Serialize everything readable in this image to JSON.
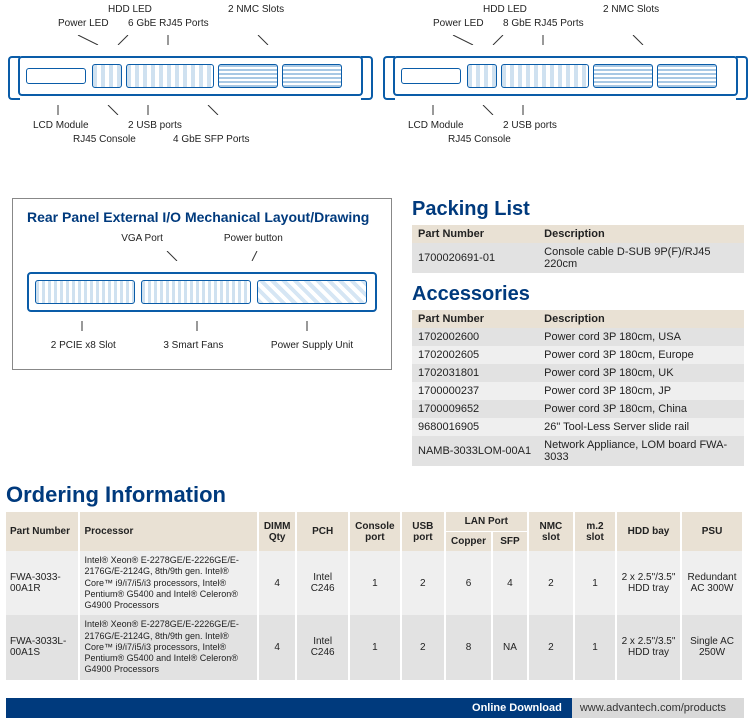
{
  "front_diag": {
    "variants": [
      {
        "top": {
          "hdd": "HDD LED",
          "power": "Power LED",
          "rj45": "6 GbE RJ45 Ports",
          "nmc": "2 NMC Slots"
        },
        "bot": {
          "lcd": "LCD Module",
          "rj45c": "RJ45 Console",
          "usb": "2 USB ports",
          "sfp": "4 GbE SFP Ports"
        }
      },
      {
        "top": {
          "hdd": "HDD LED",
          "power": "Power LED",
          "rj45": "8 GbE RJ45 Ports",
          "nmc": "2 NMC Slots"
        },
        "bot": {
          "lcd": "LCD Module",
          "rj45c": "RJ45 Console",
          "usb": "2 USB ports"
        }
      }
    ]
  },
  "rear_panel": {
    "title": "Rear Panel External I/O Mechanical Layout/Drawing",
    "top": {
      "vga": "VGA Port",
      "pwr": "Power button"
    },
    "bot": {
      "pcie": "2 PCIE x8 Slot",
      "fans": "3 Smart Fans",
      "psu": "Power Supply Unit"
    }
  },
  "packing": {
    "title": "Packing List",
    "cols": {
      "pn": "Part Number",
      "desc": "Description"
    },
    "rows": [
      {
        "pn": "1700020691-01",
        "desc": "Console cable D-SUB 9P(F)/RJ45 220cm"
      }
    ]
  },
  "accessories": {
    "title": "Accessories",
    "cols": {
      "pn": "Part Number",
      "desc": "Description"
    },
    "rows": [
      {
        "pn": "1702002600",
        "desc": "Power cord 3P 180cm, USA"
      },
      {
        "pn": "1702002605",
        "desc": "Power cord 3P 180cm, Europe"
      },
      {
        "pn": "1702031801",
        "desc": "Power cord 3P 180cm, UK"
      },
      {
        "pn": "1700000237",
        "desc": "Power cord 3P 180cm, JP"
      },
      {
        "pn": "1700009652",
        "desc": "Power cord 3P 180cm, China"
      },
      {
        "pn": "9680016905",
        "desc": "26\" Tool-Less Server slide rail"
      },
      {
        "pn": "NAMB-3033LOM-00A1",
        "desc": "Network Appliance, LOM board FWA-3033"
      }
    ]
  },
  "ordering": {
    "title": "Ordering Information",
    "cols": {
      "pn": "Part Number",
      "proc": "Processor",
      "dimm": "DIMM Qty",
      "pch": "PCH",
      "console": "Console port",
      "usb": "USB port",
      "lan": "LAN Port",
      "copper": "Copper",
      "sfp": "SFP",
      "nmc": "NMC slot",
      "m2": "m.2 slot",
      "hdd": "HDD bay",
      "psu": "PSU"
    },
    "rows": [
      {
        "pn": "FWA-3033-00A1R",
        "proc": "Intel® Xeon® E-2278GE/E-2226GE/E-2176G/E-2124G, 8th/9th gen. Intel® Core™ i9/i7/i5/i3 processors, Intel® Pentium® G5400 and Intel® Celeron® G4900 Processors",
        "dimm": "4",
        "pch": "Intel C246",
        "console": "1",
        "usb": "2",
        "copper": "6",
        "sfp": "4",
        "nmc": "2",
        "m2": "1",
        "hdd": "2 x 2.5\"/3.5\" HDD tray",
        "psu": "Redundant AC 300W"
      },
      {
        "pn": "FWA-3033L-00A1S",
        "proc": "Intel® Xeon® E-2278GE/E-2226GE/E-2176G/E-2124G, 8th/9th gen. Intel® Core™ i9/i7/i5/i3 processors, Intel® Pentium® G5400 and Intel® Celeron® G4900 Processors",
        "dimm": "4",
        "pch": "Intel C246",
        "console": "1",
        "usb": "2",
        "copper": "8",
        "sfp": "NA",
        "nmc": "2",
        "m2": "1",
        "hdd": "2 x 2.5\"/3.5\" HDD tray",
        "psu": "Single AC 250W"
      }
    ]
  },
  "footer": {
    "label": "Online Download",
    "url": "www.advantech.com/products"
  }
}
